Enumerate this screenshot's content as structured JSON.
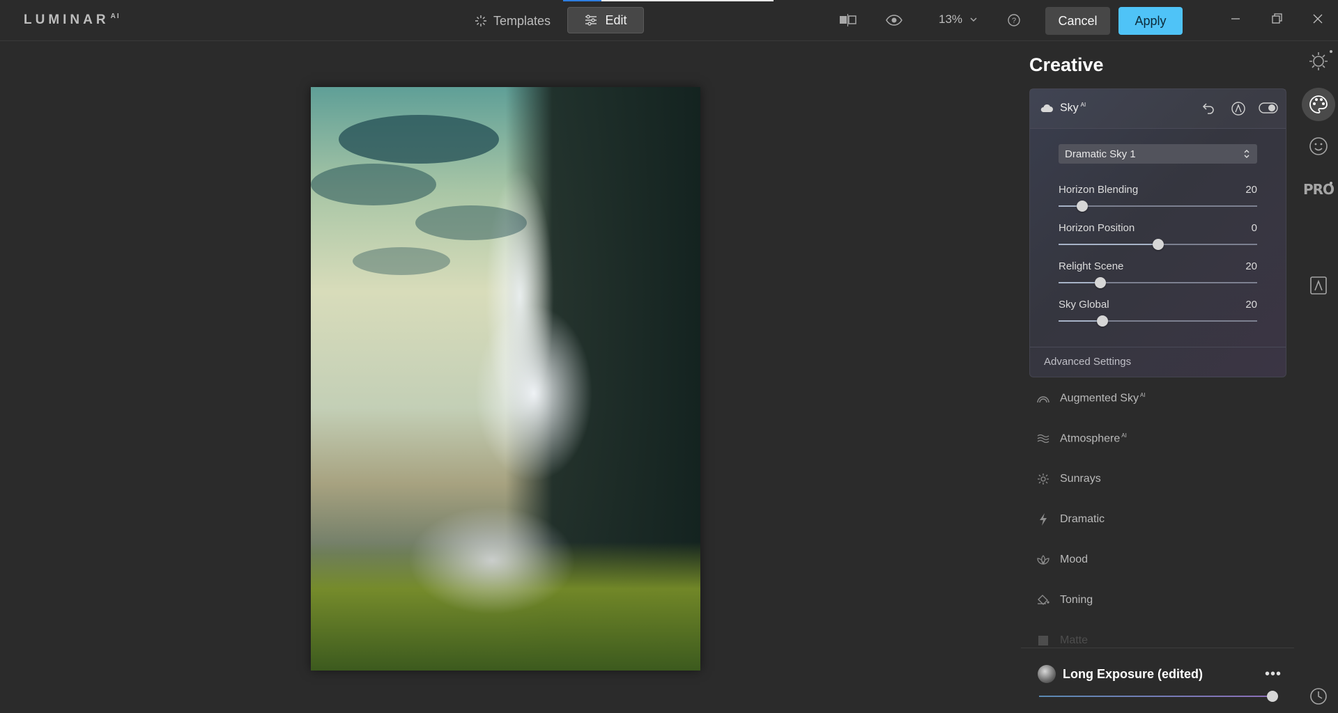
{
  "app": {
    "logo": "LUMINAR",
    "logo_suffix": "AI"
  },
  "topbar": {
    "tabs": [
      {
        "label": "Templates"
      },
      {
        "label": "Edit"
      }
    ],
    "zoom": "13%",
    "cancel_label": "Cancel",
    "apply_label": "Apply",
    "icons": [
      "compare-icon",
      "eye-icon",
      "chevron-down-icon",
      "help-icon",
      "minimize-icon",
      "restore-icon",
      "close-icon"
    ]
  },
  "panel": {
    "title": "Creative",
    "sky": {
      "title": "Sky",
      "title_suffix": "AI",
      "sky_select": "Dramatic Sky 1",
      "sliders": [
        {
          "label": "Horizon Blending",
          "value": "20",
          "fraction": 0.12
        },
        {
          "label": "Horizon Position",
          "value": "0",
          "fraction": 0.5
        },
        {
          "label": "Relight Scene",
          "value": "20",
          "fraction": 0.21
        },
        {
          "label": "Sky Global",
          "value": "20",
          "fraction": 0.22
        }
      ],
      "advanced_label": "Advanced Settings"
    },
    "tools": [
      {
        "label": "Augmented Sky",
        "suffix": "AI",
        "icon": "rainbow-icon"
      },
      {
        "label": "Atmosphere",
        "suffix": "AI",
        "icon": "waves-icon"
      },
      {
        "label": "Sunrays",
        "suffix": "",
        "icon": "sun-icon"
      },
      {
        "label": "Dramatic",
        "suffix": "",
        "icon": "lightning-icon"
      },
      {
        "label": "Mood",
        "suffix": "",
        "icon": "lotus-icon"
      },
      {
        "label": "Toning",
        "suffix": "",
        "icon": "paint-bucket-icon"
      },
      {
        "label": "Matte",
        "suffix": "",
        "icon": "square-icon"
      }
    ]
  },
  "preset": {
    "name": "Long Exposure (edited)",
    "more": "•••",
    "amount": 1.0
  },
  "rail": {
    "pro_label": "PRO",
    "items": [
      "essentials-sun-icon",
      "creative-palette-icon",
      "portrait-face-icon",
      "pro-icon",
      "local-masking-icon",
      "history-clock-icon"
    ]
  },
  "colors": {
    "accent": "#4fc3f7",
    "background": "#2b2b2b",
    "panel": "#3a3e4e"
  }
}
